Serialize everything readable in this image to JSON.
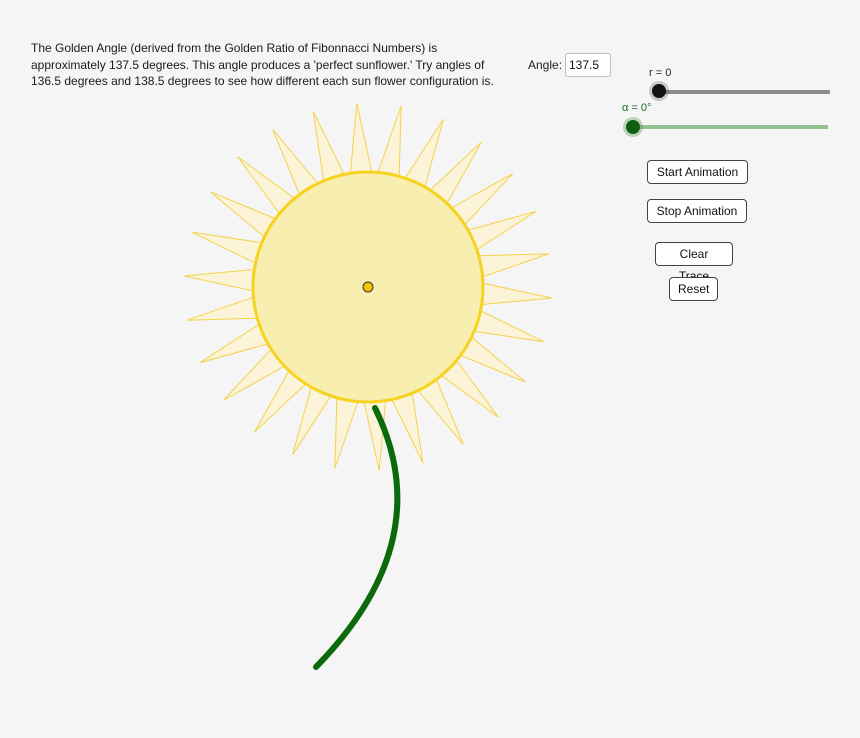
{
  "description": "The Golden Angle (derived from the Golden Ratio of Fibonnacci Numbers) is approximately 137.5 degrees. This angle produces a 'perfect sunflower.' Try angles of 136.5 degrees and 138.5 degrees to see how different each sun flower configuration is.",
  "angle": {
    "label": "Angle:",
    "value": "137.5"
  },
  "sliders": {
    "r": {
      "label": "r = 0",
      "value": 0
    },
    "alpha": {
      "label": "α = 0°",
      "value": 0
    }
  },
  "buttons": {
    "start": "Start Animation",
    "stop": "Stop Animation",
    "clear": "Clear Trace",
    "reset": "Reset"
  },
  "colors": {
    "background": "#f5f5f5",
    "petal_fill": "#fbf3d3",
    "petal_stroke": "#f5d24a",
    "disc_fill": "#f8eeb0",
    "disc_stroke": "#f7d21e",
    "stem": "#0b6a0b",
    "slider_r": "#111111",
    "slider_alpha": "#0f5f0f"
  },
  "flower": {
    "petal_count": 26
  }
}
